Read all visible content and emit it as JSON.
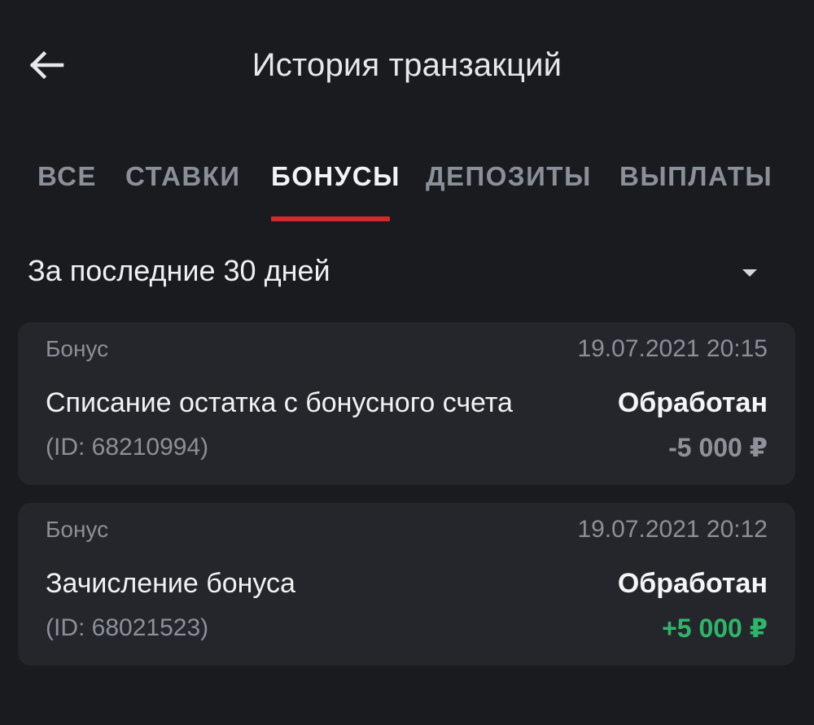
{
  "header": {
    "title": "История транзакций",
    "back_icon": "arrow-left-icon"
  },
  "tabs": [
    {
      "label": "ВСЕ",
      "active": false
    },
    {
      "label": "СТАВКИ",
      "active": false
    },
    {
      "label": "БОНУСЫ",
      "active": true
    },
    {
      "label": "ДЕПОЗИТЫ",
      "active": false
    },
    {
      "label": "ВЫПЛАТЫ",
      "active": false
    }
  ],
  "filter": {
    "period": "За последние 30 дней",
    "icon": "caret-down-icon"
  },
  "transactions": [
    {
      "type": "Бонус",
      "datetime": "19.07.2021 20:15",
      "description": "Списание остатка с бонусного счета",
      "status": "Обработан",
      "id_text": "(ID: 68210994)",
      "amount": "-5 000 ₽"
    },
    {
      "type": "Бонус",
      "datetime": "19.07.2021 20:12",
      "description": "Зачисление бонуса",
      "status": "Обработан",
      "id_text": "(ID: 68021523)",
      "amount": "+5 000 ₽"
    }
  ],
  "colors": {
    "background": "#1a1b1f",
    "card": "#24262b",
    "accent_red": "#d6282d",
    "positive_green": "#2fb56a",
    "muted_text": "#8b9098"
  }
}
